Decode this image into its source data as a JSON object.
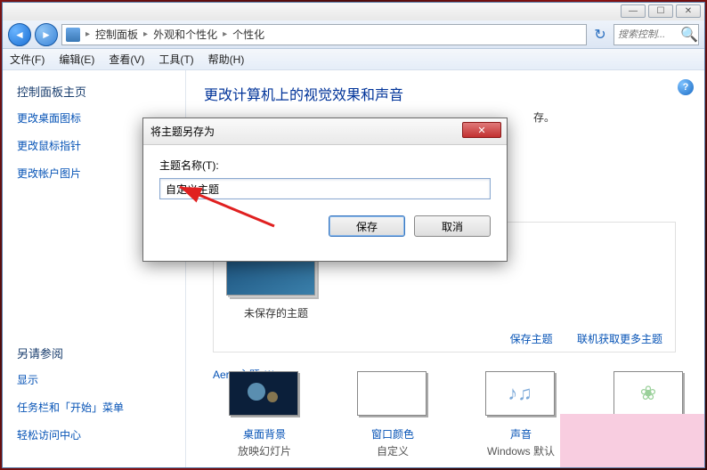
{
  "window_controls": {
    "min": "—",
    "max": "☐",
    "close": "✕"
  },
  "breadcrumb": {
    "a": "控制面板",
    "b": "外观和个性化",
    "c": "个性化"
  },
  "search": {
    "placeholder": "搜索控制..."
  },
  "menus": {
    "file": "文件(F)",
    "edit": "编辑(E)",
    "view": "查看(V)",
    "tools": "工具(T)",
    "help": "帮助(H)"
  },
  "sidebar": {
    "header": "控制面板主页",
    "links": [
      "更改桌面图标",
      "更改鼠标指针",
      "更改帐户图片"
    ],
    "seealso": "另请参阅",
    "seealso_items": [
      "显示",
      "任务栏和「开始」菜单",
      "轻松访问中心"
    ]
  },
  "page": {
    "title": "更改计算机上的视觉效果和声音",
    "remain": "存。",
    "unsaved": "未保存的主题",
    "save_link": "保存主题",
    "more_link": "联机获取更多主题",
    "aero": "Aero 主题 (1)"
  },
  "tiles": {
    "bg_name": "桌面背景",
    "bg_sub": "放映幻灯片",
    "color_name": "窗口颜色",
    "color_sub": "自定义",
    "sound_name": "声音",
    "sound_sub": "Windows 默认",
    "saver_name": "",
    "saver_sub": ""
  },
  "dialog": {
    "title": "将主题另存为",
    "label": "主题名称(T):",
    "value": "自定义主题",
    "save": "保存",
    "cancel": "取消"
  },
  "icons": {
    "help": "?",
    "sound": "♪♫",
    "saver": "❀",
    "back": "◄",
    "fwd": "►",
    "refresh": "↻",
    "search": "🔍",
    "close": "✕"
  }
}
